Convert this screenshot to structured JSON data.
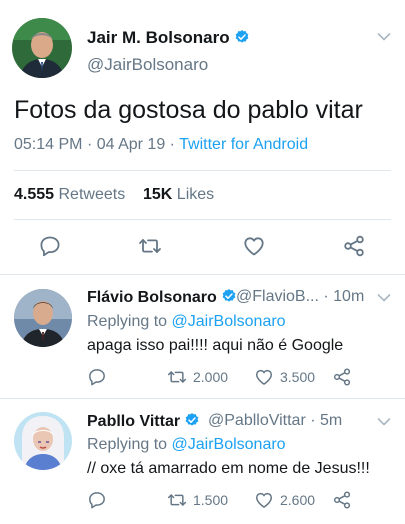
{
  "main_tweet": {
    "author_name": "Jair M. Bolsonaro",
    "author_handle": "@JairBolsonaro",
    "text": "Fotos da gostosa do pablo vitar",
    "time": "05:14 PM",
    "date": "04 Apr 19",
    "source": "Twitter for Android",
    "retweets_count": "4.555",
    "retweets_label": "Retweets",
    "likes_count": "15K",
    "likes_label": "Likes"
  },
  "replies": [
    {
      "author_name": "Flávio Bolsonaro",
      "author_handle": "@FlavioB...",
      "time_ago": "10m",
      "replying_label": "Replying to",
      "replying_handle": "@JairBolsonaro",
      "text": "apaga isso pai!!!! aqui não é Google",
      "retweets": "2.000",
      "likes": "3.500"
    },
    {
      "author_name": "Pabllo Vittar",
      "author_handle": "@PablloVittar",
      "time_ago": "5m",
      "replying_label": "Replying to",
      "replying_handle": "@JairBolsonaro",
      "text": "// oxe tá amarrado em nome de Jesus!!!",
      "retweets": "1.500",
      "likes": "2.600"
    }
  ],
  "colors": {
    "accent": "#1da1f2",
    "muted": "#657786",
    "text": "#14171a",
    "divider": "#e1e8ed"
  },
  "icons": [
    "verified-badge-icon",
    "chevron-down-icon",
    "reply-icon",
    "retweet-icon",
    "like-icon",
    "share-icon"
  ]
}
